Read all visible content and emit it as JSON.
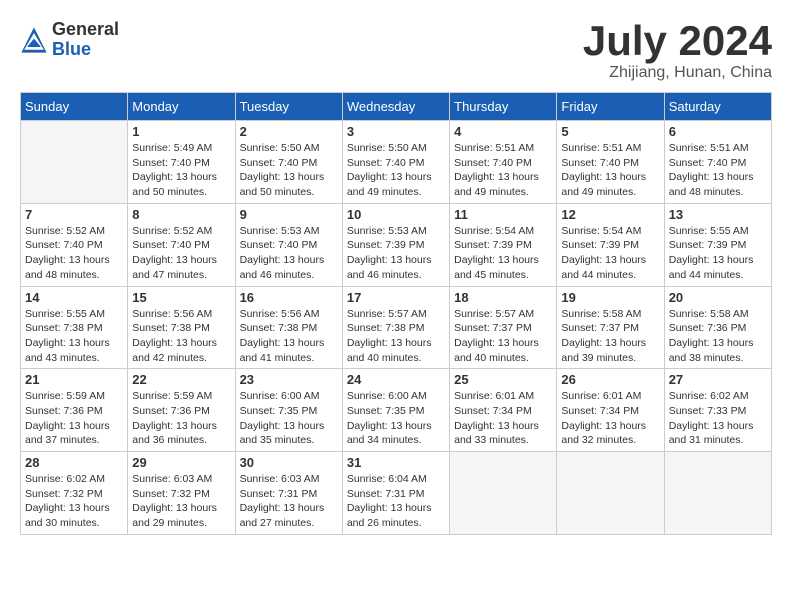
{
  "header": {
    "logo": {
      "general": "General",
      "blue": "Blue"
    },
    "title": "July 2024",
    "location": "Zhijiang, Hunan, China"
  },
  "weekdays": [
    "Sunday",
    "Monday",
    "Tuesday",
    "Wednesday",
    "Thursday",
    "Friday",
    "Saturday"
  ],
  "weeks": [
    [
      {
        "day": "",
        "sunrise": "",
        "sunset": "",
        "daylight": ""
      },
      {
        "day": "1",
        "sunrise": "Sunrise: 5:49 AM",
        "sunset": "Sunset: 7:40 PM",
        "daylight": "Daylight: 13 hours and 50 minutes."
      },
      {
        "day": "2",
        "sunrise": "Sunrise: 5:50 AM",
        "sunset": "Sunset: 7:40 PM",
        "daylight": "Daylight: 13 hours and 50 minutes."
      },
      {
        "day": "3",
        "sunrise": "Sunrise: 5:50 AM",
        "sunset": "Sunset: 7:40 PM",
        "daylight": "Daylight: 13 hours and 49 minutes."
      },
      {
        "day": "4",
        "sunrise": "Sunrise: 5:51 AM",
        "sunset": "Sunset: 7:40 PM",
        "daylight": "Daylight: 13 hours and 49 minutes."
      },
      {
        "day": "5",
        "sunrise": "Sunrise: 5:51 AM",
        "sunset": "Sunset: 7:40 PM",
        "daylight": "Daylight: 13 hours and 49 minutes."
      },
      {
        "day": "6",
        "sunrise": "Sunrise: 5:51 AM",
        "sunset": "Sunset: 7:40 PM",
        "daylight": "Daylight: 13 hours and 48 minutes."
      }
    ],
    [
      {
        "day": "7",
        "sunrise": "Sunrise: 5:52 AM",
        "sunset": "Sunset: 7:40 PM",
        "daylight": "Daylight: 13 hours and 48 minutes."
      },
      {
        "day": "8",
        "sunrise": "Sunrise: 5:52 AM",
        "sunset": "Sunset: 7:40 PM",
        "daylight": "Daylight: 13 hours and 47 minutes."
      },
      {
        "day": "9",
        "sunrise": "Sunrise: 5:53 AM",
        "sunset": "Sunset: 7:40 PM",
        "daylight": "Daylight: 13 hours and 46 minutes."
      },
      {
        "day": "10",
        "sunrise": "Sunrise: 5:53 AM",
        "sunset": "Sunset: 7:39 PM",
        "daylight": "Daylight: 13 hours and 46 minutes."
      },
      {
        "day": "11",
        "sunrise": "Sunrise: 5:54 AM",
        "sunset": "Sunset: 7:39 PM",
        "daylight": "Daylight: 13 hours and 45 minutes."
      },
      {
        "day": "12",
        "sunrise": "Sunrise: 5:54 AM",
        "sunset": "Sunset: 7:39 PM",
        "daylight": "Daylight: 13 hours and 44 minutes."
      },
      {
        "day": "13",
        "sunrise": "Sunrise: 5:55 AM",
        "sunset": "Sunset: 7:39 PM",
        "daylight": "Daylight: 13 hours and 44 minutes."
      }
    ],
    [
      {
        "day": "14",
        "sunrise": "Sunrise: 5:55 AM",
        "sunset": "Sunset: 7:38 PM",
        "daylight": "Daylight: 13 hours and 43 minutes."
      },
      {
        "day": "15",
        "sunrise": "Sunrise: 5:56 AM",
        "sunset": "Sunset: 7:38 PM",
        "daylight": "Daylight: 13 hours and 42 minutes."
      },
      {
        "day": "16",
        "sunrise": "Sunrise: 5:56 AM",
        "sunset": "Sunset: 7:38 PM",
        "daylight": "Daylight: 13 hours and 41 minutes."
      },
      {
        "day": "17",
        "sunrise": "Sunrise: 5:57 AM",
        "sunset": "Sunset: 7:38 PM",
        "daylight": "Daylight: 13 hours and 40 minutes."
      },
      {
        "day": "18",
        "sunrise": "Sunrise: 5:57 AM",
        "sunset": "Sunset: 7:37 PM",
        "daylight": "Daylight: 13 hours and 40 minutes."
      },
      {
        "day": "19",
        "sunrise": "Sunrise: 5:58 AM",
        "sunset": "Sunset: 7:37 PM",
        "daylight": "Daylight: 13 hours and 39 minutes."
      },
      {
        "day": "20",
        "sunrise": "Sunrise: 5:58 AM",
        "sunset": "Sunset: 7:36 PM",
        "daylight": "Daylight: 13 hours and 38 minutes."
      }
    ],
    [
      {
        "day": "21",
        "sunrise": "Sunrise: 5:59 AM",
        "sunset": "Sunset: 7:36 PM",
        "daylight": "Daylight: 13 hours and 37 minutes."
      },
      {
        "day": "22",
        "sunrise": "Sunrise: 5:59 AM",
        "sunset": "Sunset: 7:36 PM",
        "daylight": "Daylight: 13 hours and 36 minutes."
      },
      {
        "day": "23",
        "sunrise": "Sunrise: 6:00 AM",
        "sunset": "Sunset: 7:35 PM",
        "daylight": "Daylight: 13 hours and 35 minutes."
      },
      {
        "day": "24",
        "sunrise": "Sunrise: 6:00 AM",
        "sunset": "Sunset: 7:35 PM",
        "daylight": "Daylight: 13 hours and 34 minutes."
      },
      {
        "day": "25",
        "sunrise": "Sunrise: 6:01 AM",
        "sunset": "Sunset: 7:34 PM",
        "daylight": "Daylight: 13 hours and 33 minutes."
      },
      {
        "day": "26",
        "sunrise": "Sunrise: 6:01 AM",
        "sunset": "Sunset: 7:34 PM",
        "daylight": "Daylight: 13 hours and 32 minutes."
      },
      {
        "day": "27",
        "sunrise": "Sunrise: 6:02 AM",
        "sunset": "Sunset: 7:33 PM",
        "daylight": "Daylight: 13 hours and 31 minutes."
      }
    ],
    [
      {
        "day": "28",
        "sunrise": "Sunrise: 6:02 AM",
        "sunset": "Sunset: 7:32 PM",
        "daylight": "Daylight: 13 hours and 30 minutes."
      },
      {
        "day": "29",
        "sunrise": "Sunrise: 6:03 AM",
        "sunset": "Sunset: 7:32 PM",
        "daylight": "Daylight: 13 hours and 29 minutes."
      },
      {
        "day": "30",
        "sunrise": "Sunrise: 6:03 AM",
        "sunset": "Sunset: 7:31 PM",
        "daylight": "Daylight: 13 hours and 27 minutes."
      },
      {
        "day": "31",
        "sunrise": "Sunrise: 6:04 AM",
        "sunset": "Sunset: 7:31 PM",
        "daylight": "Daylight: 13 hours and 26 minutes."
      },
      {
        "day": "",
        "sunrise": "",
        "sunset": "",
        "daylight": ""
      },
      {
        "day": "",
        "sunrise": "",
        "sunset": "",
        "daylight": ""
      },
      {
        "day": "",
        "sunrise": "",
        "sunset": "",
        "daylight": ""
      }
    ]
  ]
}
